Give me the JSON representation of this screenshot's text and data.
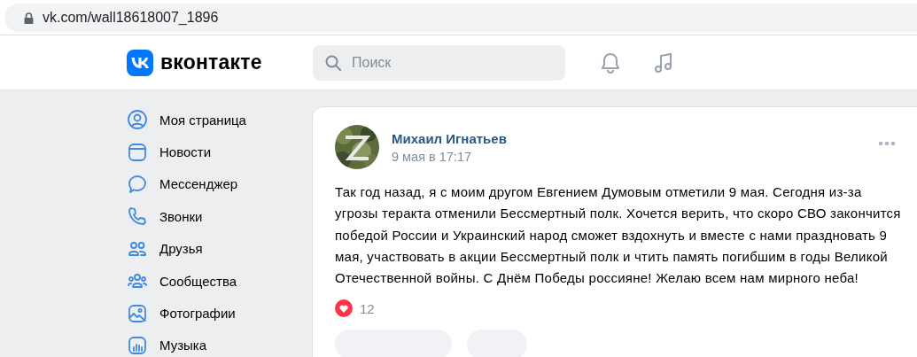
{
  "browser": {
    "url": "vk.com/wall18618007_1896"
  },
  "header": {
    "logo_text": "вконтакте",
    "search": {
      "placeholder": "Поиск"
    }
  },
  "sidebar": {
    "items": [
      {
        "label": "Моя страница"
      },
      {
        "label": "Новости"
      },
      {
        "label": "Мессенджер"
      },
      {
        "label": "Звонки"
      },
      {
        "label": "Друзья"
      },
      {
        "label": "Сообщества"
      },
      {
        "label": "Фотографии"
      },
      {
        "label": "Музыка"
      }
    ]
  },
  "post": {
    "author": "Михаил Игнатьев",
    "date": "9 мая в 17:17",
    "text": "Так год назад, я с моим другом Евгением Думовым отметили 9 мая. Сегодня из-за угрозы теракта отменили Бессмертный полк. Хочется верить, что скоро СВО закончится победой России и Украинский народ сможет вздохнуть и вместе с нами праздновать 9 мая, участвовать в акции Бессмертный полк и чтить память погибшим в годы Великой Отечественной войны. С Днём Победы россияне! Желаю всем нам мирного неба!",
    "likes": {
      "count": "12",
      "liked": true
    }
  }
}
